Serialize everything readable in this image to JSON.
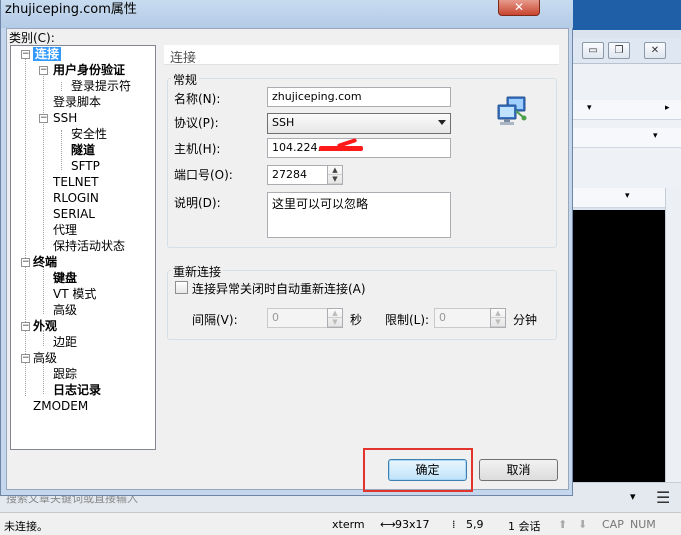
{
  "dialog": {
    "title": "zhujiceping.com属性",
    "close_label": "✕",
    "category_label": "类别(C):"
  },
  "tree": [
    {
      "label": "连接",
      "bold": true,
      "selected": true
    },
    {
      "label": "用户身份验证",
      "bold": true
    },
    {
      "label": "登录提示符"
    },
    {
      "label": "登录脚本"
    },
    {
      "label": "SSH"
    },
    {
      "label": "安全性"
    },
    {
      "label": "隧道",
      "bold": true
    },
    {
      "label": "SFTP"
    },
    {
      "label": "TELNET"
    },
    {
      "label": "RLOGIN"
    },
    {
      "label": "SERIAL"
    },
    {
      "label": "代理"
    },
    {
      "label": "保持活动状态"
    },
    {
      "label": "终端",
      "bold": true
    },
    {
      "label": "键盘",
      "bold": true
    },
    {
      "label": "VT 模式"
    },
    {
      "label": "高级"
    },
    {
      "label": "外观",
      "bold": true
    },
    {
      "label": "边距"
    },
    {
      "label": "高级"
    },
    {
      "label": "跟踪"
    },
    {
      "label": "日志记录",
      "bold": true
    },
    {
      "label": "ZMODEM"
    }
  ],
  "panel": {
    "header": "连接",
    "general": {
      "title": "常规",
      "name_label": "名称(N):",
      "name_value": "zhujiceping.com",
      "protocol_label": "协议(P):",
      "protocol_value": "SSH",
      "host_label": "主机(H):",
      "host_value": "104.224.",
      "port_label": "端口号(O):",
      "port_value": "27284",
      "desc_label": "说明(D):",
      "desc_value": "这里可以可以忽略"
    },
    "reconnect": {
      "title": "重新连接",
      "checkbox_label": "连接异常关闭时自动重新连接(A)",
      "interval_label": "间隔(V):",
      "interval_value": "0",
      "seconds_unit": "秒",
      "limit_label": "限制(L):",
      "limit_value": "0",
      "minutes_unit": "分钟"
    }
  },
  "buttons": {
    "ok": "确定",
    "cancel": "取消"
  },
  "background": {
    "lower_text": "搜索文章关键词或直接输入",
    "status": {
      "state": "未连接。",
      "term": "xterm",
      "size": "93x17",
      "pos": "5,9",
      "sessions": "1 会话",
      "caps": "CAP",
      "num": "NUM"
    }
  },
  "colors": {
    "selection": "#3399ff",
    "highlight": "#e2342c",
    "accent": "#1f5fa8"
  }
}
